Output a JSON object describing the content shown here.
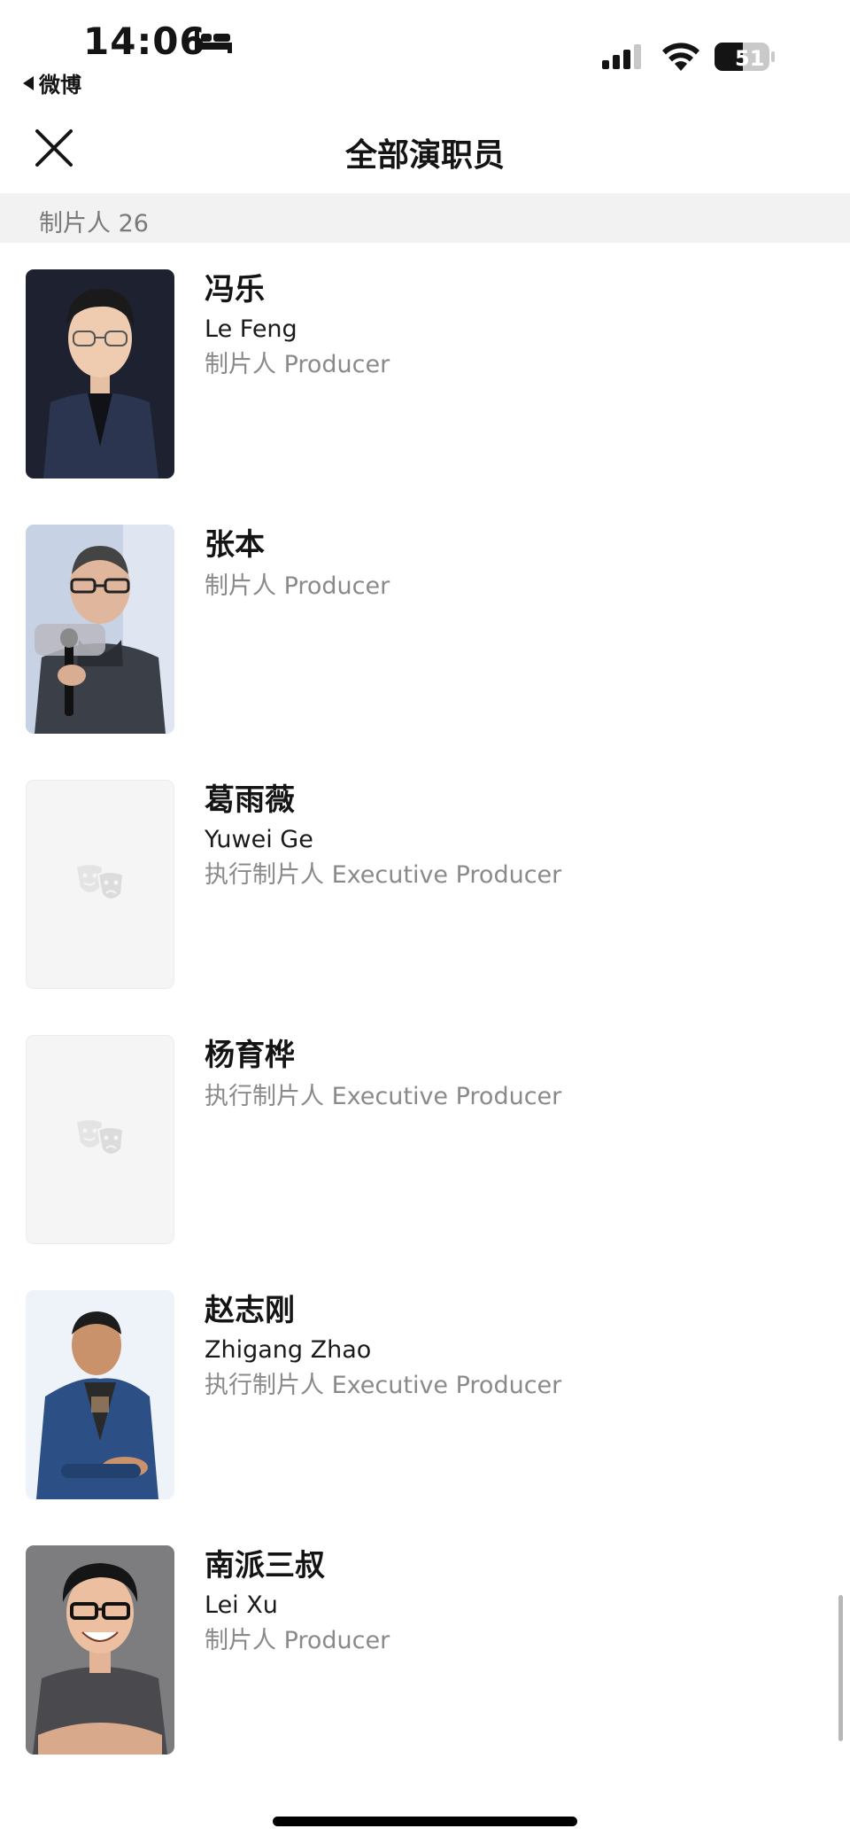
{
  "status_bar": {
    "time": "14:06",
    "back_app": "微博",
    "battery": "51"
  },
  "nav": {
    "title": "全部演职员"
  },
  "section": {
    "title": "制片人 26"
  },
  "people": [
    {
      "name_cn": "冯乐",
      "name_en": "Le Feng",
      "role": "制片人 Producer",
      "photo": "portrait-glasses-suit"
    },
    {
      "name_cn": "张本",
      "name_en": "",
      "role": "制片人 Producer",
      "photo": "portrait-microphone-hoodie"
    },
    {
      "name_cn": "葛雨薇",
      "name_en": "Yuwei Ge",
      "role": "执行制片人 Executive Producer",
      "photo": "placeholder-drama-masks-icon"
    },
    {
      "name_cn": "杨育桦",
      "name_en": "",
      "role": "执行制片人 Executive Producer",
      "photo": "placeholder-drama-masks-icon"
    },
    {
      "name_cn": "赵志刚",
      "name_en": "Zhigang Zhao",
      "role": "执行制片人 Executive Producer",
      "photo": "portrait-seated-blue-jacket"
    },
    {
      "name_cn": "南派三叔",
      "name_en": "Lei Xu",
      "role": "制片人 Producer",
      "photo": "portrait-smiling-glasses"
    }
  ],
  "icons": {
    "close": "close-icon",
    "bed": "bed-icon",
    "signal": "cellular-signal-icon",
    "wifi": "wifi-icon",
    "battery": "battery-icon",
    "placeholder": "drama-masks-icon"
  }
}
